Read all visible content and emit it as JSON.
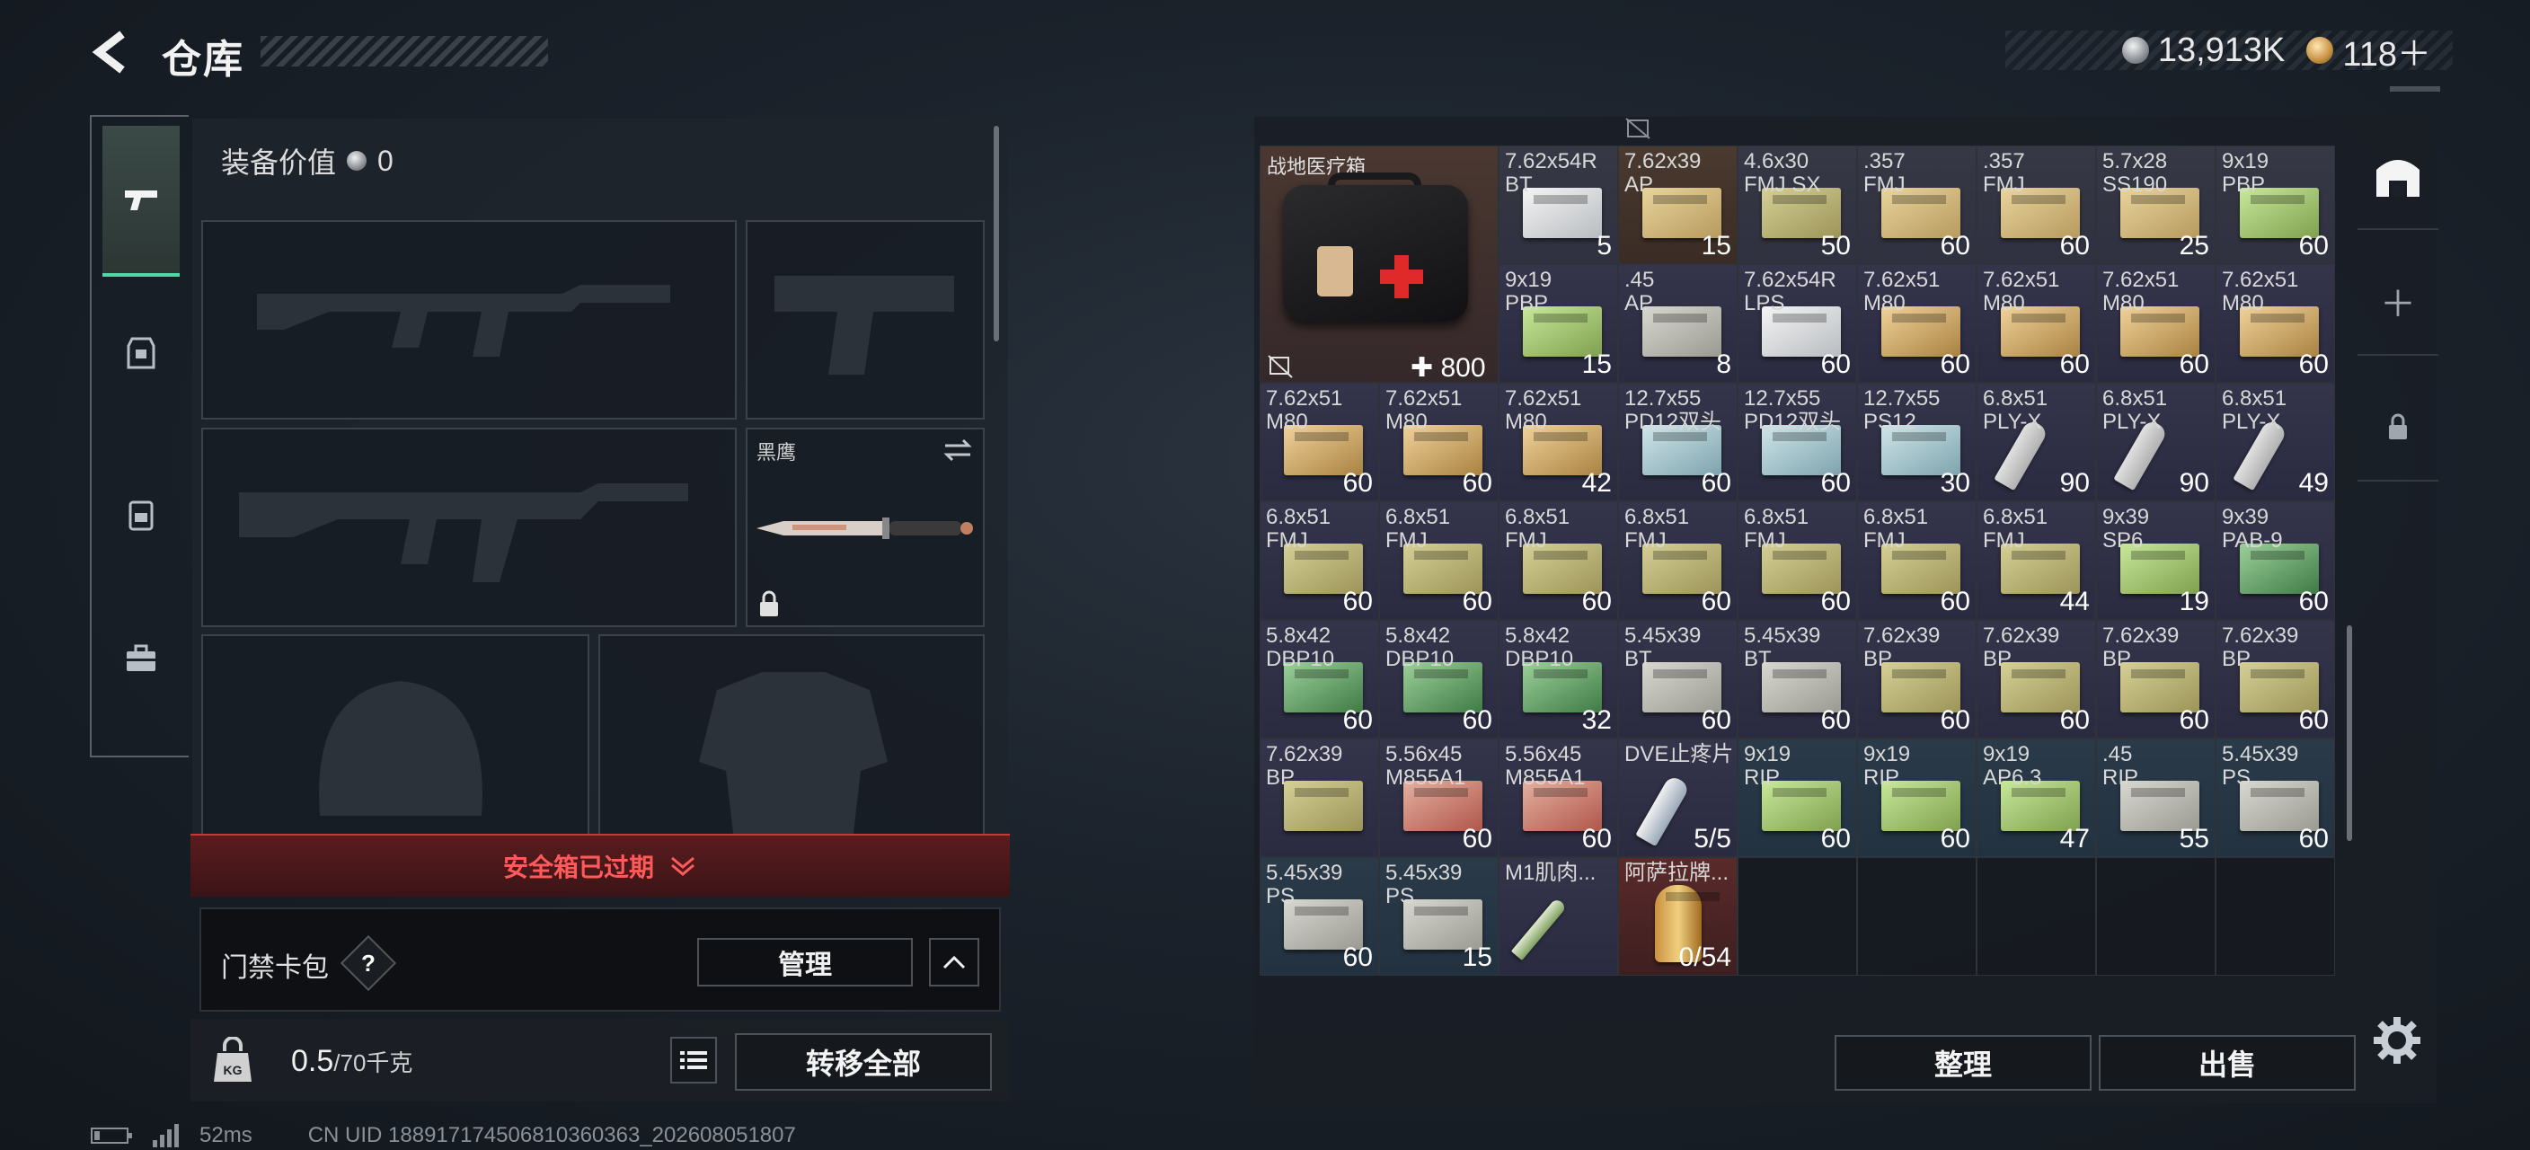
{
  "header": {
    "title": "仓库",
    "currency": [
      {
        "icon": "silver-coin-icon",
        "value": "13,913K"
      },
      {
        "icon": "gold-coin-icon",
        "value": "118＋"
      }
    ]
  },
  "left_tabs": [
    {
      "icon": "pistol-icon"
    },
    {
      "icon": "vest-icon"
    },
    {
      "icon": "backpack-icon"
    },
    {
      "icon": "briefcase-icon"
    }
  ],
  "equipment": {
    "value_label": "装备价值",
    "value": "0",
    "melee": {
      "name": "黑鹰"
    }
  },
  "safebox": {
    "status": "安全箱已过期"
  },
  "keycard": {
    "label": "门禁卡包",
    "help": "?",
    "manage": "管理"
  },
  "weight": {
    "current": "0.5",
    "max": "/70千克"
  },
  "actions": {
    "transfer_all": "转移全部",
    "sort": "整理",
    "sell": "出售"
  },
  "status_bar": {
    "ping": "52ms",
    "uid": "CN UID 188917174506810360363_202608051807"
  },
  "stash": {
    "medkit": {
      "name": "战地医疗箱",
      "count": "800"
    },
    "rows": [
      [
        {
          "name": "7.62x54R\nBT",
          "count": "5",
          "box": "box-white",
          "bg": "c-tan"
        },
        {
          "name": "7.62x39\nAP",
          "count": "15",
          "box": "box-tan",
          "bg": "c-brown"
        },
        {
          "name": "4.6x30\nFMJ SX",
          "count": "50",
          "box": "box-olive",
          "bg": "c-tan"
        },
        {
          "name": ".357\nFMJ",
          "count": "60",
          "box": "box-tan",
          "bg": "c-tan"
        },
        {
          "name": ".357\nFMJ",
          "count": "60",
          "box": "box-tan",
          "bg": "c-tan"
        },
        {
          "name": "5.7x28\nSS190",
          "count": "25",
          "box": "box-tan",
          "bg": "c-tan"
        },
        {
          "name": "9x19\nPBP",
          "count": "60",
          "box": "box-green",
          "bg": "c-tan"
        }
      ],
      [
        {
          "name": "9x19\nPBP",
          "count": "15",
          "box": "box-green",
          "bg": "c-purple"
        },
        {
          "name": ".45\nAP",
          "count": "8",
          "box": "box-grey",
          "bg": "c-purple"
        },
        {
          "name": "7.62x54R\nLPS",
          "count": "60",
          "box": "box-white",
          "bg": "c-purple"
        },
        {
          "name": "7.62x51\nM80",
          "count": "60",
          "box": "box-gold",
          "bg": "c-purple"
        },
        {
          "name": "7.62x51\nM80",
          "count": "60",
          "box": "box-gold",
          "bg": "c-purple"
        },
        {
          "name": "7.62x51\nM80",
          "count": "60",
          "box": "box-gold",
          "bg": "c-purple"
        },
        {
          "name": "7.62x51\nM80",
          "count": "60",
          "box": "box-gold",
          "bg": "c-purple"
        }
      ],
      [
        {
          "name": "7.62x51\nM80",
          "count": "60",
          "box": "box-gold",
          "bg": "c-purple"
        },
        {
          "name": "7.62x51\nM80",
          "count": "60",
          "box": "box-gold",
          "bg": "c-purple"
        },
        {
          "name": "7.62x51\nM80",
          "count": "42",
          "box": "box-gold",
          "bg": "c-purple"
        },
        {
          "name": "12.7x55\nPD12双头",
          "count": "60",
          "box": "box-blue",
          "bg": "c-purple"
        },
        {
          "name": "12.7x55\nPD12双头",
          "count": "60",
          "box": "box-blue",
          "bg": "c-purple"
        },
        {
          "name": "12.7x55\nPS12",
          "count": "30",
          "box": "box-blue",
          "bg": "c-purple"
        },
        {
          "name": "6.8x51\nPLY-X",
          "count": "90",
          "box": "shell",
          "bg": "c-purple"
        },
        {
          "name": "6.8x51\nPLY-X",
          "count": "90",
          "box": "shell",
          "bg": "c-purple"
        },
        {
          "name": "6.8x51\nPLY-X",
          "count": "49",
          "box": "shell",
          "bg": "c-purple"
        }
      ],
      [
        {
          "name": "6.8x51\nFMJ",
          "count": "60",
          "box": "box-olive",
          "bg": "c-purple"
        },
        {
          "name": "6.8x51\nFMJ",
          "count": "60",
          "box": "box-olive",
          "bg": "c-purple"
        },
        {
          "name": "6.8x51\nFMJ",
          "count": "60",
          "box": "box-olive",
          "bg": "c-purple"
        },
        {
          "name": "6.8x51\nFMJ",
          "count": "60",
          "box": "box-olive",
          "bg": "c-purple"
        },
        {
          "name": "6.8x51\nFMJ",
          "count": "60",
          "box": "box-olive",
          "bg": "c-purple"
        },
        {
          "name": "6.8x51\nFMJ",
          "count": "60",
          "box": "box-olive",
          "bg": "c-purple"
        },
        {
          "name": "6.8x51\nFMJ",
          "count": "44",
          "box": "box-olive",
          "bg": "c-purple"
        },
        {
          "name": "9x39\nSP6",
          "count": "19",
          "box": "box-green",
          "bg": "c-purple"
        },
        {
          "name": "9x39\nPAB-9",
          "count": "60",
          "box": "box-dgreen",
          "bg": "c-purple"
        }
      ],
      [
        {
          "name": "5.8x42\nDBP10",
          "count": "60",
          "box": "box-dgreen",
          "bg": "c-purple"
        },
        {
          "name": "5.8x42\nDBP10",
          "count": "60",
          "box": "box-dgreen",
          "bg": "c-purple"
        },
        {
          "name": "5.8x42\nDBP10",
          "count": "32",
          "box": "box-dgreen",
          "bg": "c-purple"
        },
        {
          "name": "5.45x39\nBT",
          "count": "60",
          "box": "box-grey",
          "bg": "c-purple"
        },
        {
          "name": "5.45x39\nBT",
          "count": "60",
          "box": "box-grey",
          "bg": "c-purple"
        },
        {
          "name": "7.62x39\nBP",
          "count": "60",
          "box": "box-olive",
          "bg": "c-purple"
        },
        {
          "name": "7.62x39\nBP",
          "count": "60",
          "box": "box-olive",
          "bg": "c-purple"
        },
        {
          "name": "7.62x39\nBP",
          "count": "60",
          "box": "box-olive",
          "bg": "c-purple"
        },
        {
          "name": "7.62x39\nBP",
          "count": "60",
          "box": "box-olive",
          "bg": "c-purple"
        }
      ],
      [
        {
          "name": "7.62x39\nBP",
          "count": "",
          "box": "box-olive",
          "bg": "c-purple"
        },
        {
          "name": "5.56x45\nM855A1",
          "count": "60",
          "box": "box-red",
          "bg": "c-purple"
        },
        {
          "name": "5.56x45\nM855A1",
          "count": "60",
          "box": "box-red",
          "bg": "c-purple"
        },
        {
          "name": "DVE止疼片",
          "count": "5/5",
          "box": "pill",
          "bg": "c-purple"
        },
        {
          "name": "9x19\nRIP",
          "count": "60",
          "box": "box-green",
          "bg": "c-blue"
        },
        {
          "name": "9x19\nRIP",
          "count": "60",
          "box": "box-green",
          "bg": "c-blue"
        },
        {
          "name": "9x19\nAP6.3",
          "count": "47",
          "box": "box-green",
          "bg": "c-blue"
        },
        {
          "name": ".45\nRIP",
          "count": "55",
          "box": "box-grey",
          "bg": "c-blue"
        },
        {
          "name": "5.45x39\nPS",
          "count": "60",
          "box": "box-grey",
          "bg": "c-blue"
        }
      ],
      [
        {
          "name": "5.45x39\nPS",
          "count": "60",
          "box": "box-grey",
          "bg": "c-blue"
        },
        {
          "name": "5.45x39\nPS",
          "count": "15",
          "box": "box-grey",
          "bg": "c-blue"
        },
        {
          "name": "M1肌肉...",
          "count": "",
          "box": "syringe",
          "bg": "c-purple"
        },
        {
          "name": "阿萨拉牌...",
          "count": "0/54",
          "box": "lighter",
          "bg": "c-red"
        },
        {
          "name": "",
          "count": "",
          "box": "",
          "bg": "c-empty"
        },
        {
          "name": "",
          "count": "",
          "box": "",
          "bg": "c-empty"
        },
        {
          "name": "",
          "count": "",
          "box": "",
          "bg": "c-empty"
        },
        {
          "name": "",
          "count": "",
          "box": "",
          "bg": "c-empty"
        },
        {
          "name": "",
          "count": "",
          "box": "",
          "bg": "c-empty"
        }
      ]
    ]
  },
  "colors": {
    "accent": "#4fd7a5",
    "warning": "#ff5a5a"
  }
}
